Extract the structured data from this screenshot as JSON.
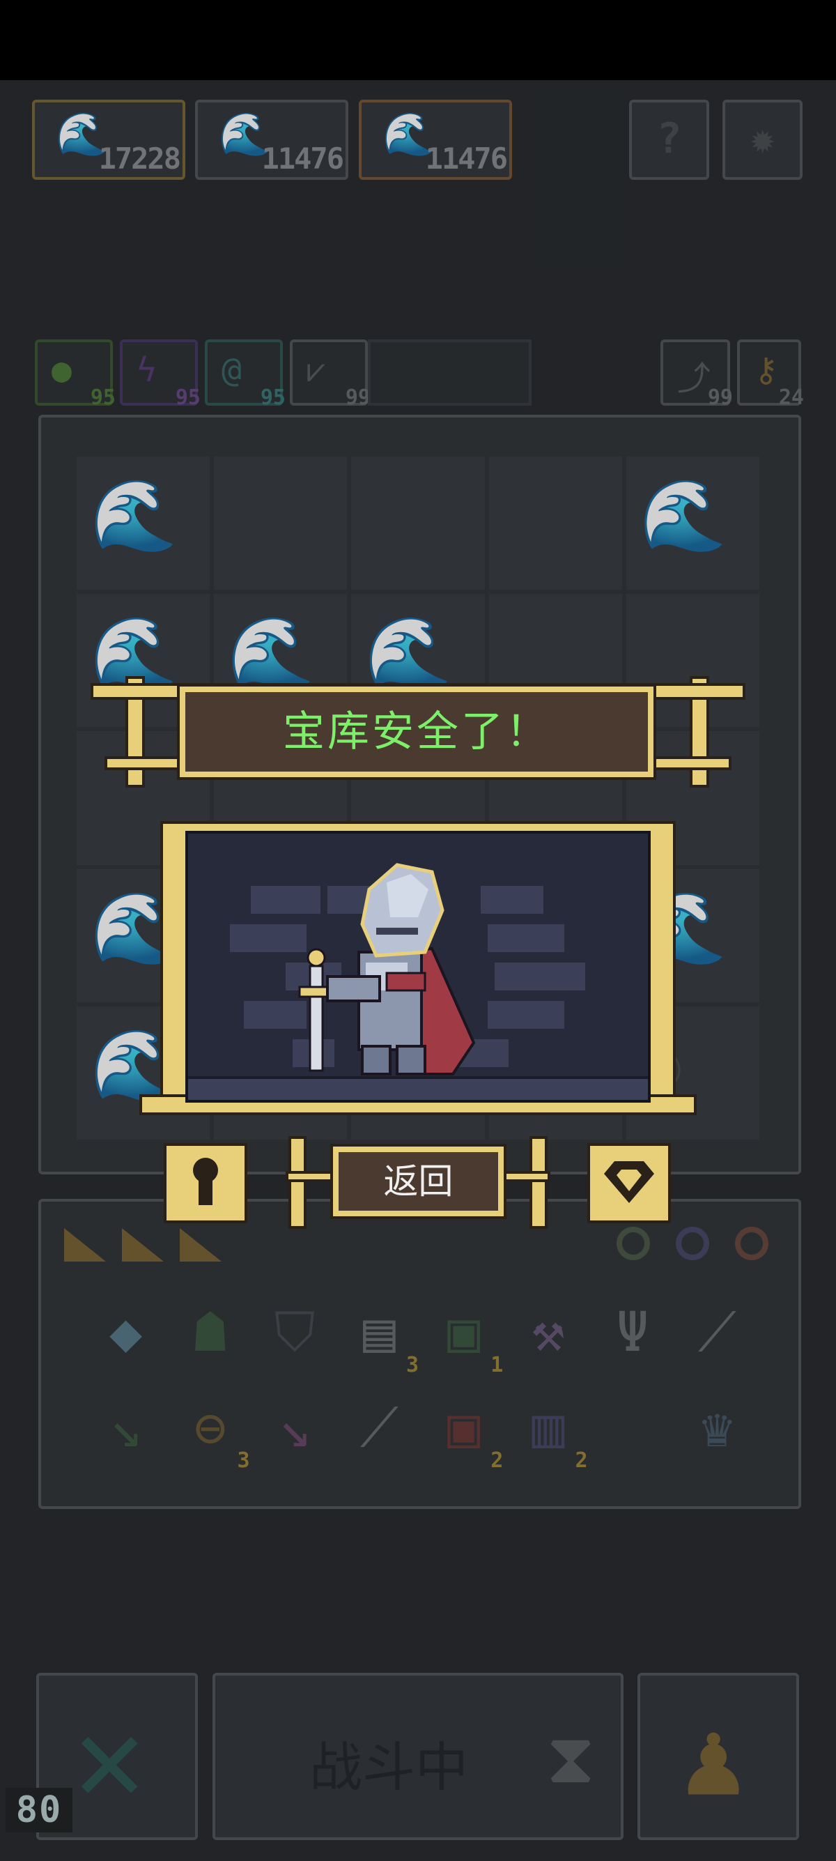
{
  "resources": [
    {
      "icon": "wave-icon",
      "value": "17228",
      "border": "#7a6a38"
    },
    {
      "icon": "wave-icon",
      "value": "11476",
      "border": "#55585c"
    },
    {
      "icon": "wave-icon",
      "value": "11476",
      "border": "#7a5838"
    }
  ],
  "top_buttons": {
    "help": "?",
    "settings": "✹"
  },
  "stats_left": [
    {
      "icon": "heart-icon",
      "value": "95",
      "color": "#4e7a3a"
    },
    {
      "icon": "lightning-icon",
      "value": "95",
      "color": "#5a3f7a"
    },
    {
      "icon": "swirl-icon",
      "value": "95",
      "color": "#3a6a6a"
    },
    {
      "icon": "bird-icon",
      "value": "99",
      "color": "#6a6a6a"
    }
  ],
  "stats_right": [
    {
      "icon": "reroll-icon",
      "value": "99"
    },
    {
      "icon": "key-icon",
      "value": "24"
    }
  ],
  "dialog": {
    "title": "宝库安全了！",
    "return_label": "返回",
    "title_color": "#7df06a",
    "frame_color": "#e8cf7a"
  },
  "inventory_badges": {
    "scroll": "3",
    "monster_card": "1",
    "shield_ring": "3",
    "red_card": "2",
    "vial": "2"
  },
  "bottom": {
    "battle_label": "战斗中"
  },
  "fps": "80"
}
